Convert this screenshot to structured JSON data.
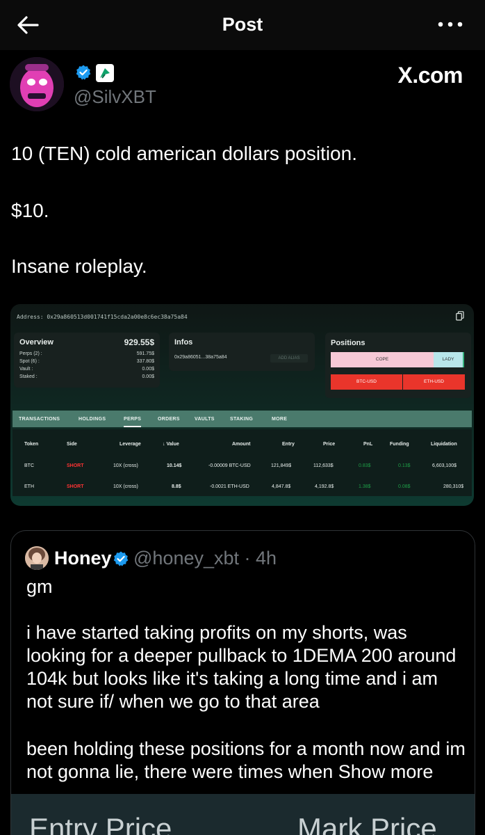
{
  "header": {
    "title": "Post"
  },
  "author": {
    "handle": "@SilvXBT",
    "site_badge": "X.com"
  },
  "post": {
    "lines": [
      "10 (TEN) cold american dollars position.",
      "$10.",
      "Insane roleplay."
    ]
  },
  "screenshot": {
    "address": "Address: 0x29a860513d001741f15cda2a00e8c6ec38a75a84",
    "overview": {
      "title": "Overview",
      "total": "929.55$",
      "rows": [
        {
          "label": "Perps (2) :",
          "value": "591.75$"
        },
        {
          "label": "Spot (6) :",
          "value": "337.80$"
        },
        {
          "label": "Vault :",
          "value": "0.00$"
        },
        {
          "label": "Staked :",
          "value": "0.00$"
        }
      ]
    },
    "infos": {
      "title": "Infos",
      "address_short": "0x29a86051...38a75a84",
      "add_alias": "ADD ALIAS"
    },
    "positions": {
      "title": "Positions",
      "cope": "COPE",
      "lady": "LADY",
      "btc": "BTC-USD",
      "eth": "ETH-USD"
    },
    "tabs": [
      "TRANSACTIONS",
      "HOLDINGS",
      "PERPS",
      "ORDERS",
      "VAULTS",
      "STAKING",
      "MORE"
    ],
    "active_tab": "PERPS",
    "columns": [
      "Token",
      "Side",
      "Leverage",
      "↓ Value",
      "Amount",
      "Entry",
      "Price",
      "PnL",
      "Funding",
      "Liquidation"
    ],
    "rows": [
      {
        "token": "BTC",
        "side": "SHORT",
        "leverage": "10X (cross)",
        "value": "10.14$",
        "amount": "-0.00009 BTC-USD",
        "entry": "121,849$",
        "price": "112,633$",
        "pnl": "0.83$",
        "funding": "0.13$",
        "liquidation": "6,603,100$"
      },
      {
        "token": "ETH",
        "side": "SHORT",
        "leverage": "10X (cross)",
        "value": "8.8$",
        "amount": "-0.0021 ETH-USD",
        "entry": "4,847.8$",
        "price": "4,192.8$",
        "pnl": "1.38$",
        "funding": "0.08$",
        "liquidation": "280,310$"
      }
    ]
  },
  "quote": {
    "name": "Honey",
    "handle_time": "@honey_xbt · 4h",
    "lines": [
      "gm",
      "i have started taking profits on my shorts, was looking for a deeper pullback to 1DEMA 200 around 104k but looks like it's taking a long time and i am not sure if/ when we go to that area",
      "been holding these positions for a month now and im not gonna lie, there were times when"
    ],
    "show_more": "Show more",
    "image_labels": [
      "Entry Price",
      "Mark Price"
    ]
  },
  "colors": {
    "short": "#ff3333",
    "pnl": "#1e9e47",
    "verified": "#1d9bf0"
  }
}
